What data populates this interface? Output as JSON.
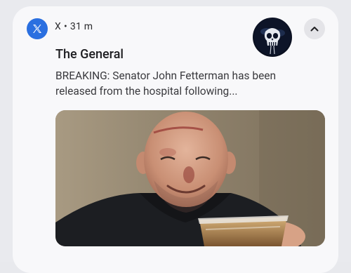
{
  "notification": {
    "app_icon": "x-logo-icon",
    "source": "X",
    "separator": "•",
    "time": "31 m",
    "avatar_icon": "skull-avatar-icon",
    "collapse_icon": "chevron-up-icon",
    "title": "The General",
    "body_line_1": "BREAKING: Senator John Fetterman has been",
    "body_line_2": "released from the hospital following...",
    "image": "photo of smiling bald man with facial bruises holding a cup"
  },
  "colors": {
    "app_icon_bg": "#2a6fe0",
    "card_bg": "#f8f8fa",
    "shade_bg": "#e9eaee"
  }
}
